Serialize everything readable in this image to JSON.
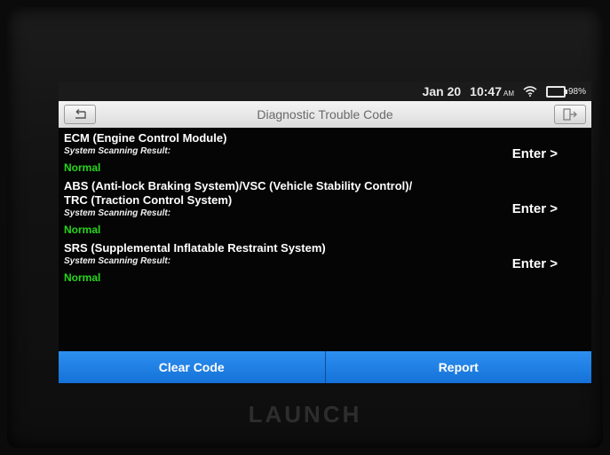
{
  "status": {
    "date": "Jan 20",
    "time": "10:47",
    "ampm": "AM",
    "battery": "98%"
  },
  "header": {
    "title": "Diagnostic Trouble Code",
    "back_icon": "back-arrow-icon",
    "exit_icon": "exit-icon"
  },
  "systems": [
    {
      "name_line1": "ECM (Engine Control Module)",
      "name_line2": "",
      "scan_label": "System Scanning Result:",
      "result": "Normal",
      "enter": "Enter >"
    },
    {
      "name_line1": "ABS (Anti-lock Braking System)/VSC (Vehicle Stability Control)/",
      "name_line2": "TRC (Traction Control System)",
      "scan_label": "System Scanning Result:",
      "result": "Normal",
      "enter": "Enter >"
    },
    {
      "name_line1": "SRS (Supplemental Inflatable Restraint System)",
      "name_line2": "",
      "scan_label": "System Scanning Result:",
      "result": "Normal",
      "enter": "Enter >"
    }
  ],
  "actions": {
    "clear_code": "Clear Code",
    "report": "Report"
  },
  "device": {
    "brand": "LAUNCH"
  },
  "colors": {
    "accent": "#1f80e6",
    "normal": "#27d61c",
    "background": "#050505"
  }
}
